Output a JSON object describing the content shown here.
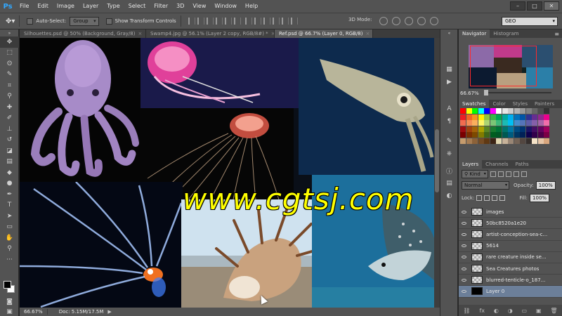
{
  "app": {
    "logo": "Ps"
  },
  "menu": [
    "File",
    "Edit",
    "Image",
    "Layer",
    "Type",
    "Select",
    "Filter",
    "3D",
    "View",
    "Window",
    "Help"
  ],
  "window_controls": [
    "–",
    "□",
    "✕"
  ],
  "options": {
    "auto_select_label": "Auto-Select:",
    "auto_select_value": "Group",
    "show_transform_label": "Show Transform Controls",
    "mode_3d_label": "3D Mode:",
    "workspace": "GEO"
  },
  "tabs": [
    {
      "label": "Silhouettes.psd @ 50% (Background, Gray/8)",
      "active": false
    },
    {
      "label": "Swamp4.jpg @ 56.1% (Layer 2 copy, RGB/8#) *",
      "active": false
    },
    {
      "label": "Ref.psd @ 66.7% (Layer 0, RGB/8)",
      "active": true
    }
  ],
  "tab_close": "×",
  "status": {
    "zoom": "66.67%",
    "doc": "Doc: 5.15M/17.5M",
    "arrow": "▶"
  },
  "watermark": "www.cgtsj.com",
  "navigator": {
    "tabs": [
      "Navigator",
      "Histogram"
    ],
    "zoom": "66.67%",
    "menu": "≡"
  },
  "swatches": {
    "tabs": [
      "Swatches",
      "Color",
      "Styles",
      "Painters"
    ],
    "colors": [
      "#ff0000",
      "#ffff00",
      "#00ff00",
      "#00ffff",
      "#0000ff",
      "#ff00ff",
      "#ffffff",
      "#e6e6e6",
      "#cccccc",
      "#b3b3b3",
      "#999999",
      "#808080",
      "#666666",
      "#4d4d4d",
      "#333333",
      "#ed1c24",
      "#f26522",
      "#f7941d",
      "#fff200",
      "#8dc63f",
      "#39b54a",
      "#00a651",
      "#00a99d",
      "#00aeef",
      "#0072bc",
      "#0054a6",
      "#2e3192",
      "#662d91",
      "#92278f",
      "#ec008c",
      "#f26c4f",
      "#f68e56",
      "#fbaf5d",
      "#fff467",
      "#acd373",
      "#7cc576",
      "#3cb878",
      "#1cbbb4",
      "#00bff3",
      "#448ccb",
      "#5574b9",
      "#605ca8",
      "#855fa8",
      "#a763a8",
      "#f06eaa",
      "#9e0b0f",
      "#a0410d",
      "#a36209",
      "#aba000",
      "#598527",
      "#197b30",
      "#007236",
      "#00746b",
      "#0076a3",
      "#004b80",
      "#003471",
      "#1b1464",
      "#440e62",
      "#630460",
      "#9e005d",
      "#790000",
      "#7b2e00",
      "#7d4900",
      "#827b00",
      "#406618",
      "#005e20",
      "#005826",
      "#005952",
      "#005b7f",
      "#003663",
      "#002157",
      "#0d004c",
      "#32004b",
      "#4b0049",
      "#7b0046",
      "#c69c6d",
      "#a67c52",
      "#8c6239",
      "#754c24",
      "#603913",
      "#3c2415",
      "#e0d6b0",
      "#c7b299",
      "#998675",
      "#736357",
      "#534741",
      "#362f2d",
      "#f5e3c8",
      "#e8c7a8",
      "#d9a77e"
    ]
  },
  "layers": {
    "tabs": [
      "Layers",
      "Channels",
      "Paths"
    ],
    "kind": "Kind",
    "blend_mode": "Normal",
    "opacity_label": "Opacity:",
    "opacity": "100%",
    "lock_label": "Lock:",
    "fill_label": "Fill:",
    "fill": "100%",
    "items": [
      {
        "name": "images",
        "selected": false
      },
      {
        "name": "50bc8520a1e20",
        "selected": false
      },
      {
        "name": "artist-conception-sea-c...",
        "selected": false
      },
      {
        "name": "5614",
        "selected": false
      },
      {
        "name": "rare creature inside se...",
        "selected": false
      },
      {
        "name": "Sea Creatures photos",
        "selected": false
      },
      {
        "name": "blurred-tenticle-o_187...",
        "selected": false
      },
      {
        "name": "Layer 0",
        "selected": true
      }
    ],
    "footer_icons": [
      "⛓",
      "fx",
      "◐",
      "◑",
      "▭",
      "▣",
      "🗑"
    ]
  }
}
